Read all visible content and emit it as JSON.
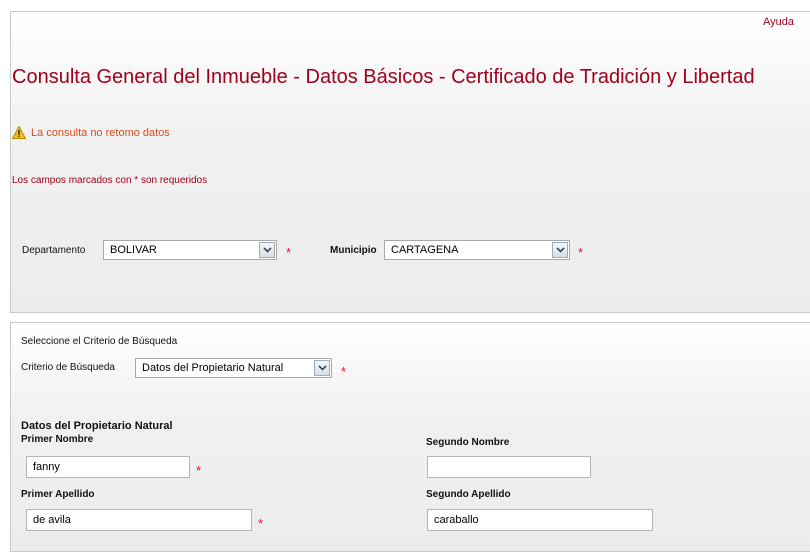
{
  "header": {
    "help_label": "Ayuda",
    "title": "Consulta General del Inmueble - Datos Básicos - Certificado de Tradición y Libertad"
  },
  "messages": {
    "warning": "La consulta no retomo datos",
    "required_note": "Los campos marcados con * son requeridos"
  },
  "location": {
    "departamento_label": "Departamento",
    "departamento_value": "BOLIVAR",
    "municipio_label": "Municipio",
    "municipio_value": "CARTAGENA"
  },
  "search": {
    "section_title": "Seleccione el Criterio de Búsqueda",
    "criterio_label": "Criterio de Búsqueda",
    "criterio_value": "Datos del Propietario Natural"
  },
  "owner": {
    "section_title": "Datos del Propietario Natural",
    "primer_nombre_label": "Primer Nombre",
    "primer_nombre_value": "fanny",
    "segundo_nombre_label": "Segundo Nombre",
    "segundo_nombre_value": "",
    "primer_apellido_label": "Primer Apellido",
    "primer_apellido_value": "de avila",
    "segundo_apellido_label": "Segundo Apellido",
    "segundo_apellido_value": "caraballo"
  },
  "required_marker": "*",
  "icons": {
    "warning": "warning-icon",
    "dropdown": "chevron-down-icon"
  },
  "colors": {
    "accent": "#a1001c",
    "warning": "#d3501e",
    "required": "#e8112d"
  }
}
